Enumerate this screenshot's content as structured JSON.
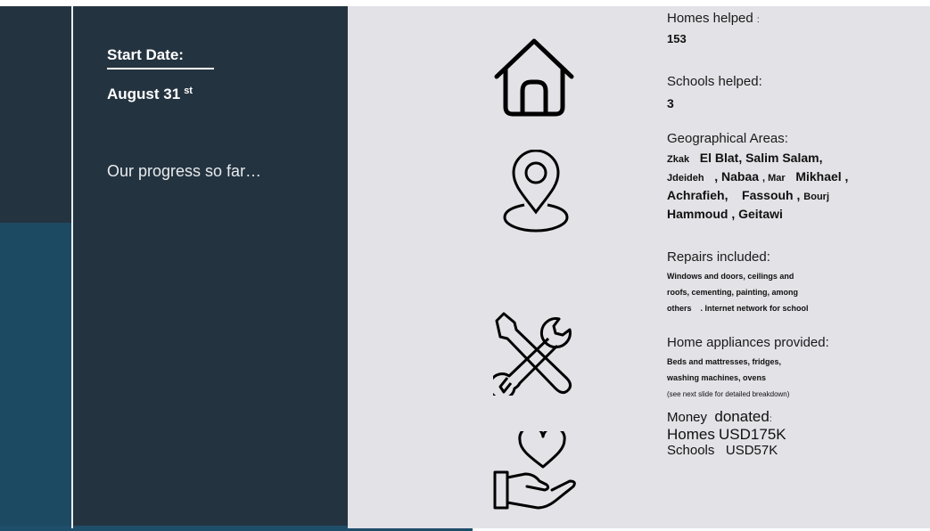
{
  "left": {
    "start_label": "Start Date:",
    "start_date": "August 31",
    "start_date_suffix": "st",
    "progress": "Our progress so far…"
  },
  "icons": [
    "house-icon",
    "location-pin-icon",
    "tools-icon",
    "heart-hand-icon"
  ],
  "stats": {
    "homes_header": "Homes helped",
    "homes_colon": ":",
    "homes_value": "153",
    "schools_header": "Schools helped:",
    "schools_value": "3",
    "areas_header": "Geographical Areas:",
    "areas": [
      "Zkak",
      "El Blat, Salim Salam,",
      "Jdeideh",
      ", Nabaa",
      ", Mar",
      "Mikhael ,",
      "Achrafieh,",
      "Fassouh ,",
      "Bourj",
      "Hammoud , Geitawi"
    ],
    "repairs_header": "Repairs included:",
    "repairs_lines": [
      "Windows and doors, ceilings and",
      "roofs, cementing, painting, among",
      "others",
      ". Internet network for school"
    ],
    "appliances_header": "Home appliances provided:",
    "appliances_lines": [
      "Beds and mattresses, fridges,",
      "washing machines, ovens"
    ],
    "appliances_note": "(see next slide for detailed breakdown)",
    "money_header": "Money",
    "money_word": "donated",
    "money_colon": ":",
    "money_homes_label": "Homes",
    "money_homes_value": "USD175K",
    "money_schools_label": "Schools",
    "money_schools_value": "USD57K"
  }
}
